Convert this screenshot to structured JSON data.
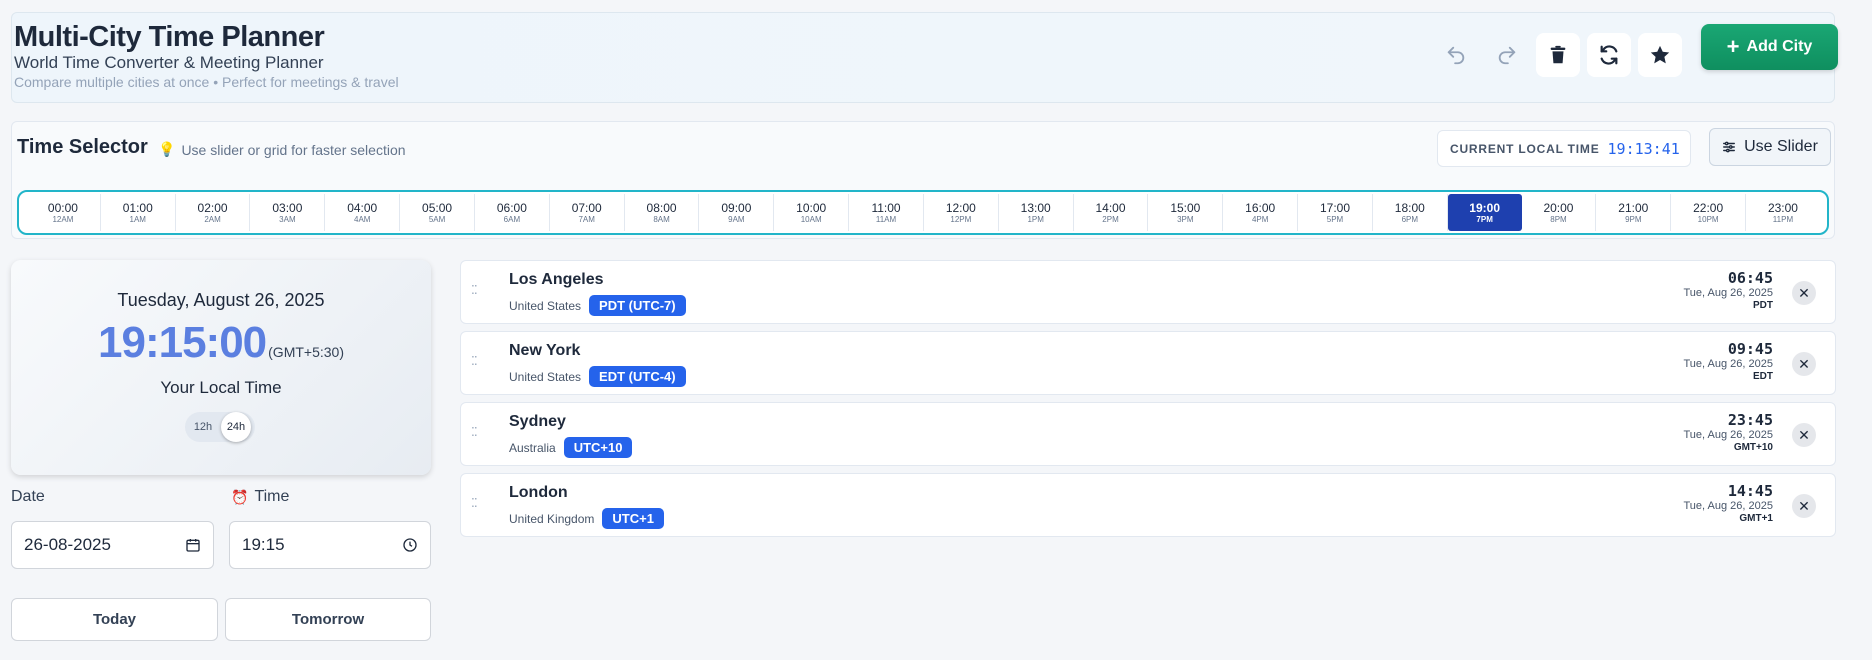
{
  "header": {
    "title": "Multi-City Time Planner",
    "subtitle": "World Time Converter & Meeting Planner",
    "tagline": "Compare multiple cities at once • Perfect for meetings & travel",
    "icons": [
      "undo-icon",
      "redo-icon",
      "trash-icon",
      "refresh-icon",
      "star-icon"
    ],
    "add_city_label": "Add City",
    "accent": "#129a69"
  },
  "selector": {
    "title": "Time Selector",
    "hint": "Use slider or grid for faster selection",
    "current_label": "CURRENT LOCAL TIME",
    "current_value": "19:13:41",
    "slider_button": "Use Slider",
    "active_hour": 19,
    "hours": [
      {
        "h24": "00:00",
        "h12": "12AM"
      },
      {
        "h24": "01:00",
        "h12": "1AM"
      },
      {
        "h24": "02:00",
        "h12": "2AM"
      },
      {
        "h24": "03:00",
        "h12": "3AM"
      },
      {
        "h24": "04:00",
        "h12": "4AM"
      },
      {
        "h24": "05:00",
        "h12": "5AM"
      },
      {
        "h24": "06:00",
        "h12": "6AM"
      },
      {
        "h24": "07:00",
        "h12": "7AM"
      },
      {
        "h24": "08:00",
        "h12": "8AM"
      },
      {
        "h24": "09:00",
        "h12": "9AM"
      },
      {
        "h24": "10:00",
        "h12": "10AM"
      },
      {
        "h24": "11:00",
        "h12": "11AM"
      },
      {
        "h24": "12:00",
        "h12": "12PM"
      },
      {
        "h24": "13:00",
        "h12": "1PM"
      },
      {
        "h24": "14:00",
        "h12": "2PM"
      },
      {
        "h24": "15:00",
        "h12": "3PM"
      },
      {
        "h24": "16:00",
        "h12": "4PM"
      },
      {
        "h24": "17:00",
        "h12": "5PM"
      },
      {
        "h24": "18:00",
        "h12": "6PM"
      },
      {
        "h24": "19:00",
        "h12": "7PM"
      },
      {
        "h24": "20:00",
        "h12": "8PM"
      },
      {
        "h24": "21:00",
        "h12": "9PM"
      },
      {
        "h24": "22:00",
        "h12": "10PM"
      },
      {
        "h24": "23:00",
        "h12": "11PM"
      }
    ]
  },
  "local": {
    "date": "Tuesday, August 26, 2025",
    "time": "19:15:00",
    "offset": "(GMT+5:30)",
    "label": "Your Local Time",
    "toggle_12": "12h",
    "toggle_24": "24h"
  },
  "form": {
    "date_label": "Date",
    "date_value": "26-08-2025",
    "time_label": "Time",
    "time_value": "19:15",
    "today": "Today",
    "tomorrow": "Tomorrow"
  },
  "cities": [
    {
      "name": "Los Angeles",
      "country": "United States",
      "badge": "PDT (UTC-7)",
      "time": "06:45",
      "date": "Tue, Aug 26, 2025",
      "abbr": "PDT"
    },
    {
      "name": "New York",
      "country": "United States",
      "badge": "EDT (UTC-4)",
      "time": "09:45",
      "date": "Tue, Aug 26, 2025",
      "abbr": "EDT"
    },
    {
      "name": "Sydney",
      "country": "Australia",
      "badge": "UTC+10",
      "time": "23:45",
      "date": "Tue, Aug 26, 2025",
      "abbr": "GMT+10"
    },
    {
      "name": "London",
      "country": "United Kingdom",
      "badge": "UTC+1",
      "time": "14:45",
      "date": "Tue, Aug 26, 2025",
      "abbr": "GMT+1"
    }
  ]
}
